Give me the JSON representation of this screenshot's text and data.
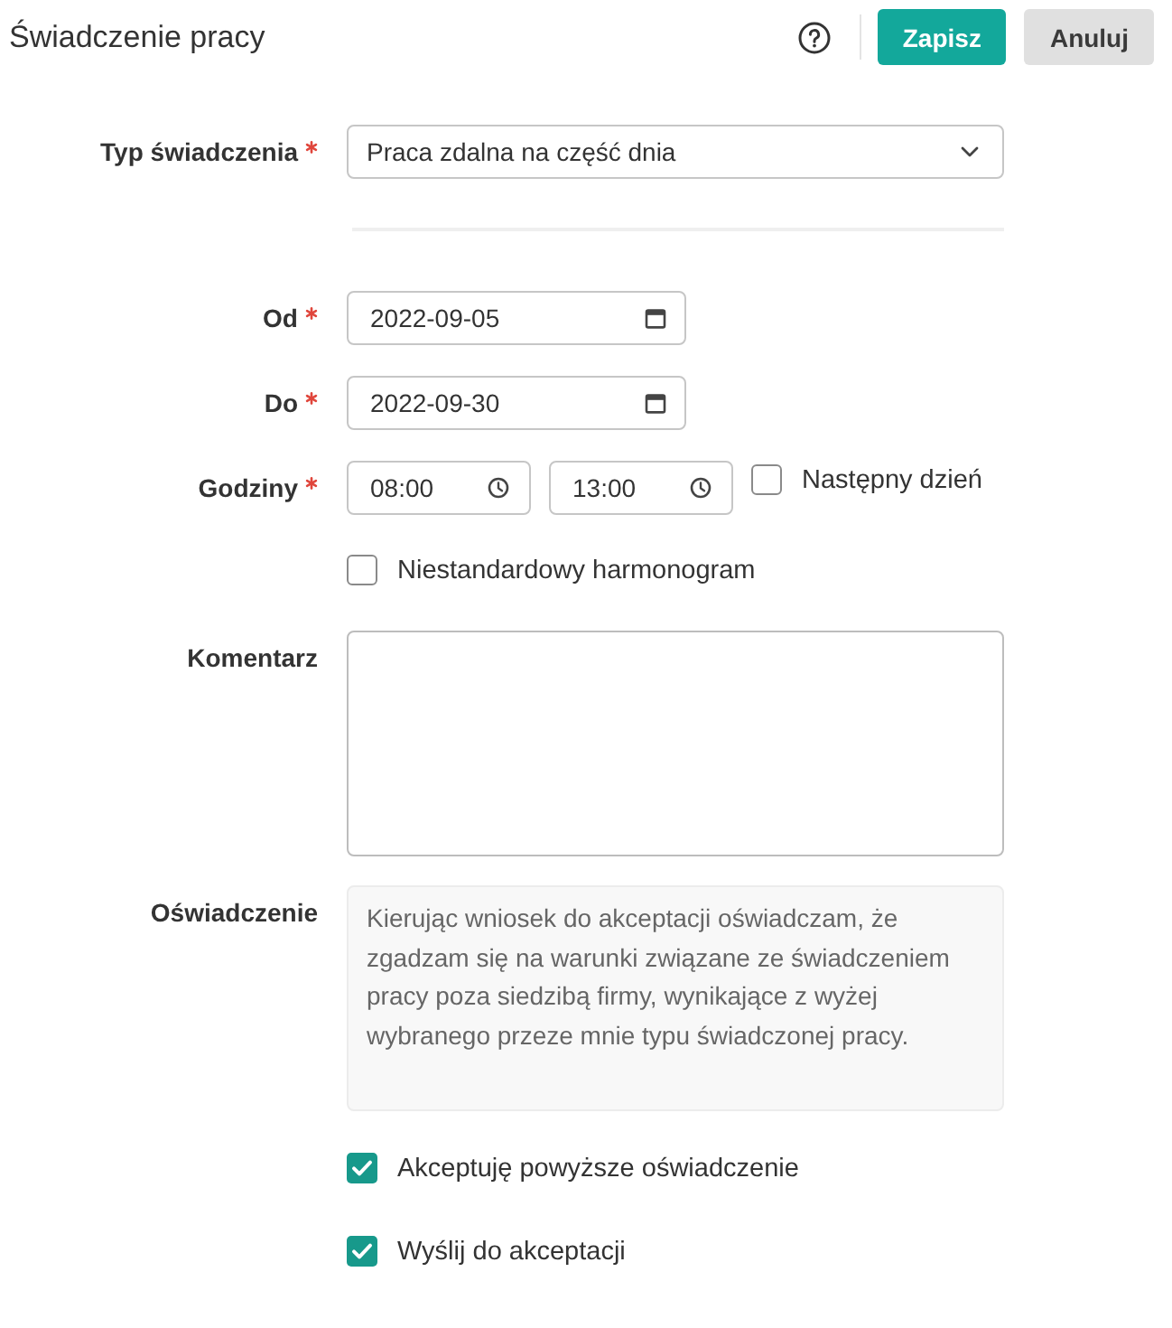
{
  "header": {
    "title": "Świadczenie pracy",
    "buttons": [
      {
        "kind": "save",
        "label": "Zapisz"
      },
      {
        "kind": "cancel",
        "label": "Anuluj"
      }
    ]
  },
  "form": {
    "fields": [
      {
        "kind": "select",
        "label": "Typ świadczenia",
        "required": true,
        "value": "Praca zdalna na część dnia"
      },
      {
        "kind": "separator"
      },
      {
        "kind": "date",
        "label": "Od",
        "required": true,
        "value": "2022-09-05"
      },
      {
        "kind": "date",
        "label": "Do",
        "required": true,
        "value": "2022-09-30"
      },
      {
        "kind": "time_range",
        "label": "Godziny",
        "required": true,
        "from": "08:00",
        "to": "13:00",
        "next_day": {
          "label": "Następny dzień",
          "checked": false
        }
      },
      {
        "kind": "checkbox",
        "label": "Niestandardowy harmonogram",
        "checked": false
      },
      {
        "kind": "textarea",
        "label": "Komentarz",
        "required": false
      },
      {
        "kind": "statement",
        "label": "Oświadczenie",
        "required": false,
        "text": "Kierując wniosek do akceptacji oświadczam, że zgadzam się na warunki związane ze świadczeniem pracy poza siedzibą firmy, wynikające z wyżej wybranego przeze mnie typu świadczonej pracy."
      },
      {
        "kind": "checkbox",
        "label": "Akceptuję powyższe oświadczenie",
        "checked": true
      },
      {
        "kind": "checkbox",
        "label": "Wyślij do akceptacji",
        "checked": true
      }
    ]
  }
}
